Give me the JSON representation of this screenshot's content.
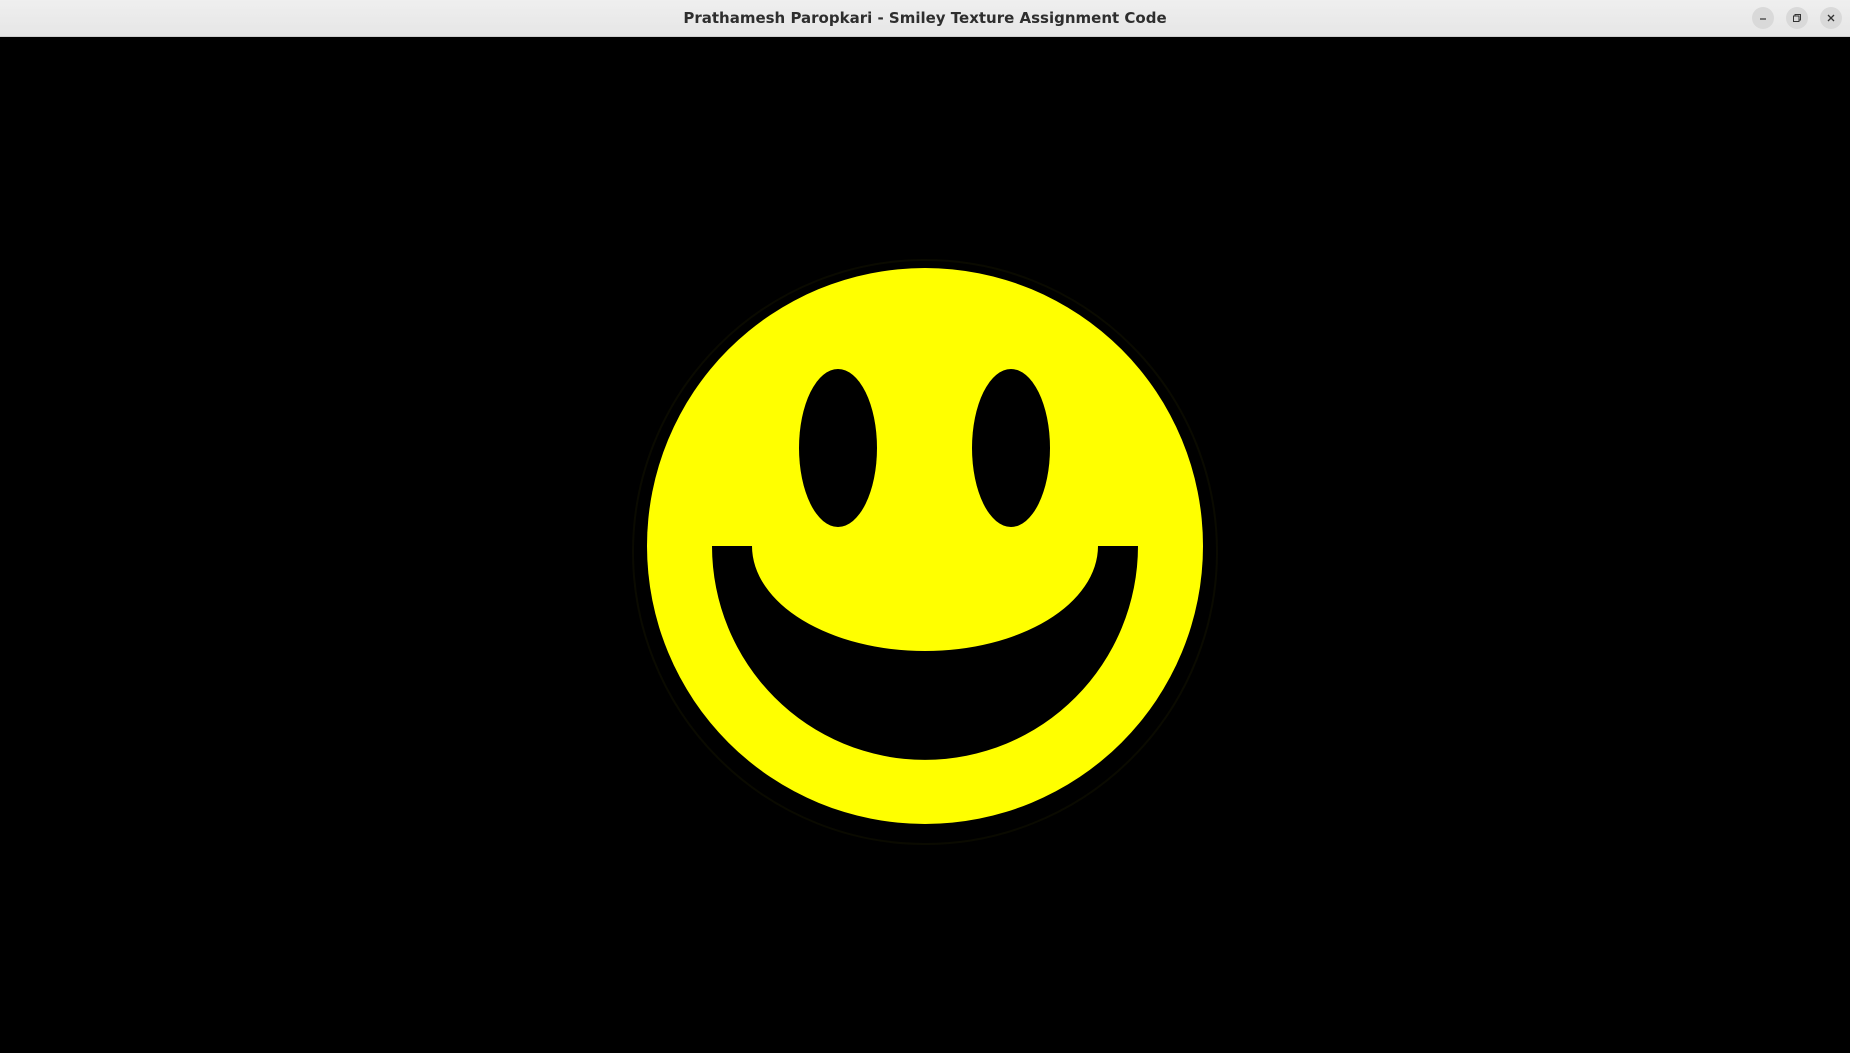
{
  "window": {
    "title": "Prathamesh Paropkari - Smiley Texture Assignment Code",
    "controls": {
      "minimize": "minimize-icon",
      "restore": "restore-icon",
      "close": "close-icon"
    }
  },
  "scene": {
    "background_color": "#000000",
    "face_color": "#ffff00",
    "feature_color": "#000000"
  }
}
